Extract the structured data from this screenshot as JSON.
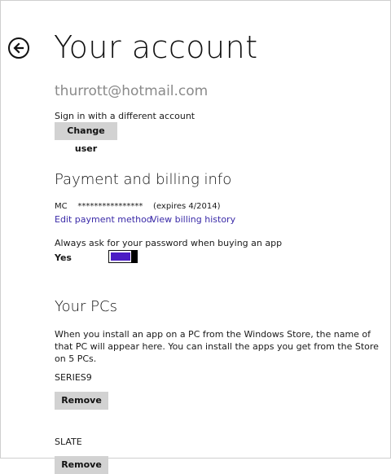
{
  "header": {
    "title": "Your account"
  },
  "account": {
    "email": "thurrott@hotmail.com",
    "signin_text": "Sign in with a different account",
    "change_user_label": "Change user"
  },
  "payment": {
    "heading": "Payment and billing info",
    "card_line": "MC    ****************    (expires 4/2014)",
    "edit_link": "Edit payment method",
    "history_link": "View billing history",
    "ask_password_text": "Always ask for your password when buying an app",
    "toggle_value_label": "Yes",
    "toggle_on": true,
    "accent_color": "#4b1cc4"
  },
  "pcs": {
    "heading": "Your PCs",
    "description": "When you install an app on a PC from the Windows Store, the name of that PC will appear here. You can install the apps you get from the Store on 5 PCs.",
    "items": [
      {
        "name": "SERIES9",
        "remove_label": "Remove"
      },
      {
        "name": "SLATE",
        "remove_label": "Remove"
      }
    ]
  },
  "icons": {
    "back": "back-arrow-icon"
  }
}
